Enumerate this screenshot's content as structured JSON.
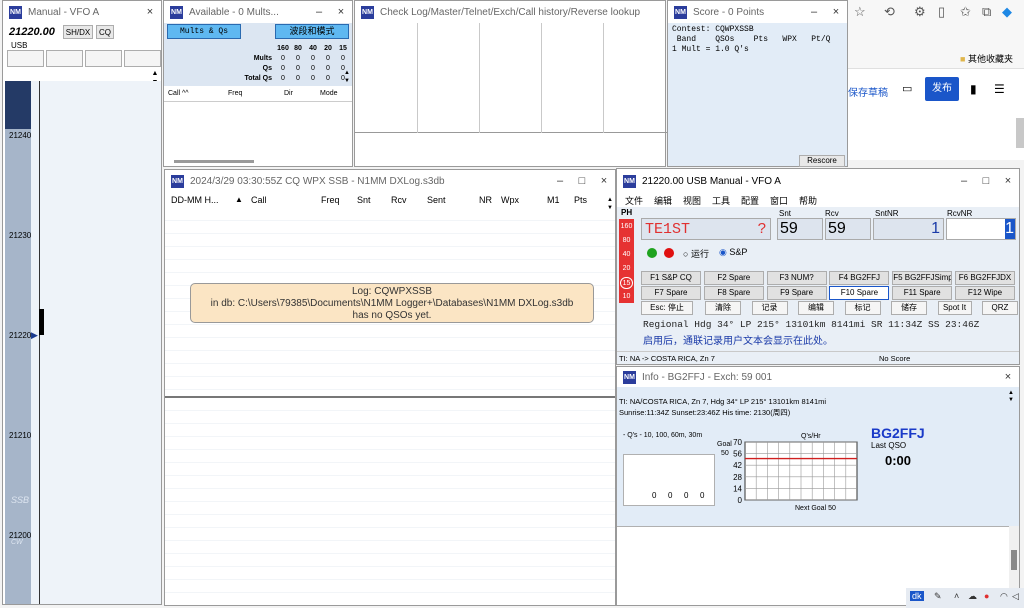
{
  "browser": {
    "bookmark_folder": "其他收藏夹",
    "draft_label": "保存草稿",
    "publish_label": "发布"
  },
  "vfoa": {
    "title": "Manual - VFO A",
    "freq": "21220.00",
    "mode": "USB",
    "btn1": "SH/DX",
    "btn2": "CQ",
    "ticks": [
      "21240",
      "21230",
      "21220",
      "21210",
      "21200"
    ],
    "band_label": "SSB",
    "cw_label": "CW"
  },
  "mults": {
    "title": "Available - 0 Mults...",
    "btn1": "Mults & Qs",
    "btn2": "波段和模式",
    "bands": [
      "160",
      "80",
      "40",
      "20",
      "15"
    ],
    "rows": [
      {
        "label": "Mults",
        "vals": [
          "0",
          "0",
          "0",
          "0",
          "0"
        ]
      },
      {
        "label": "Qs",
        "vals": [
          "0",
          "0",
          "0",
          "0",
          "0"
        ]
      },
      {
        "label": "Total Qs",
        "vals": [
          "0",
          "0",
          "0",
          "0",
          "0"
        ]
      }
    ],
    "cols": [
      "Call ^^",
      "Freq",
      "Dir",
      "Mode"
    ]
  },
  "check": {
    "title": "Check Log/Master/Telnet/Exch/Call history/Reverse lookup"
  },
  "score": {
    "title": "Score - 0 Points",
    "line1": "Contest: CQWPXSSB",
    "line2": " Band    QSOs    Pts   WPX   Pt/Q",
    "line3": "1 Mult = 1.0 Q's",
    "rescore": "Rescore"
  },
  "log": {
    "title": "2024/3/29 03:30:55Z  CQ WPX SSB - N1MM DXLog.s3db",
    "cols": [
      "DD-MM H...",
      "Call",
      "Freq",
      "Snt",
      "Rcv",
      "Sent",
      "NR",
      "Wpx",
      "M1",
      "Pts"
    ],
    "msg1": "Log: CQWPXSSB",
    "msg2": "in db: C:\\Users\\79385\\Documents\\N1MM Logger+\\Databases\\N1MM DXLog.s3db",
    "msg3": "has no QSOs yet."
  },
  "entry": {
    "title": "21220.00 USB Manual - VFO A",
    "menu": [
      "文件",
      "编辑",
      "视图",
      "工具",
      "配置",
      "窗口",
      "帮助"
    ],
    "ph": "PH",
    "bands": [
      "160",
      "80",
      "40",
      "20",
      "15",
      "10"
    ],
    "lbl_snt": "Snt",
    "lbl_rcv": "Rcv",
    "lbl_sntnr": "SntNR",
    "lbl_rcvnr": "RcvNR",
    "call": "TE1ST",
    "q": "?",
    "snt": "59",
    "rcv": "59",
    "sntnr": "1",
    "rcvnr": "1",
    "run": "运行",
    "sp": "S&P",
    "fkeys": [
      "F1 S&P CQ",
      "F2 Spare",
      "F3 NUM?",
      "F4 BG2FFJ",
      "F5 BG2FFJSimp",
      "F6 BG2FFJDX",
      "F7 Spare",
      "F8 Spare",
      "F9 Spare",
      "F10 Spare",
      "F11 Spare",
      "F12 Wipe"
    ],
    "keys": [
      "Esc: 停止",
      "清除",
      "记录",
      "编辑",
      "标记",
      "储存",
      "Spot It",
      "QRZ"
    ],
    "info1": "Regional Hdg 34° LP 215° 13101km 8141mi SR 11:34Z SS 23:46Z",
    "info2": "启用后，通联记录用户文本会显示在此处。",
    "status_left": "TI: NA -> COSTA RICA, Zn 7",
    "status_right": "No Score"
  },
  "info": {
    "title": "Info - BG2FFJ - Exch: 59 001",
    "line1": "TI: NA/COSTA RICA, Zn 7, Hdg 34° LP 215° 13101km 8141mi",
    "line2": "Sunrise:11:34Z Sunset:23:46Z His time: 2130(周四)",
    "qs_title": "- Q's - 10, 100, 60m, 30m",
    "goal_label": "Goal",
    "goal_val": "50",
    "qs_vals": [
      "0",
      "0",
      "0",
      "0"
    ],
    "rate_title": "Q's/Hr",
    "rate_ticks": [
      "70",
      "56",
      "42",
      "28",
      "14",
      "0"
    ],
    "next_goal": "Next Goal 50",
    "callsign": "BG2FFJ",
    "last_qso": "Last QSO",
    "time": "0:00"
  },
  "chart_data": {
    "type": "line",
    "title": "Q's/Hr",
    "ylim": [
      0,
      70
    ],
    "yticks": [
      70,
      56,
      42,
      28,
      14,
      0
    ],
    "series": [
      {
        "name": "goal",
        "values": [
          50,
          50
        ]
      }
    ],
    "xlabel": "Next Goal 50"
  }
}
